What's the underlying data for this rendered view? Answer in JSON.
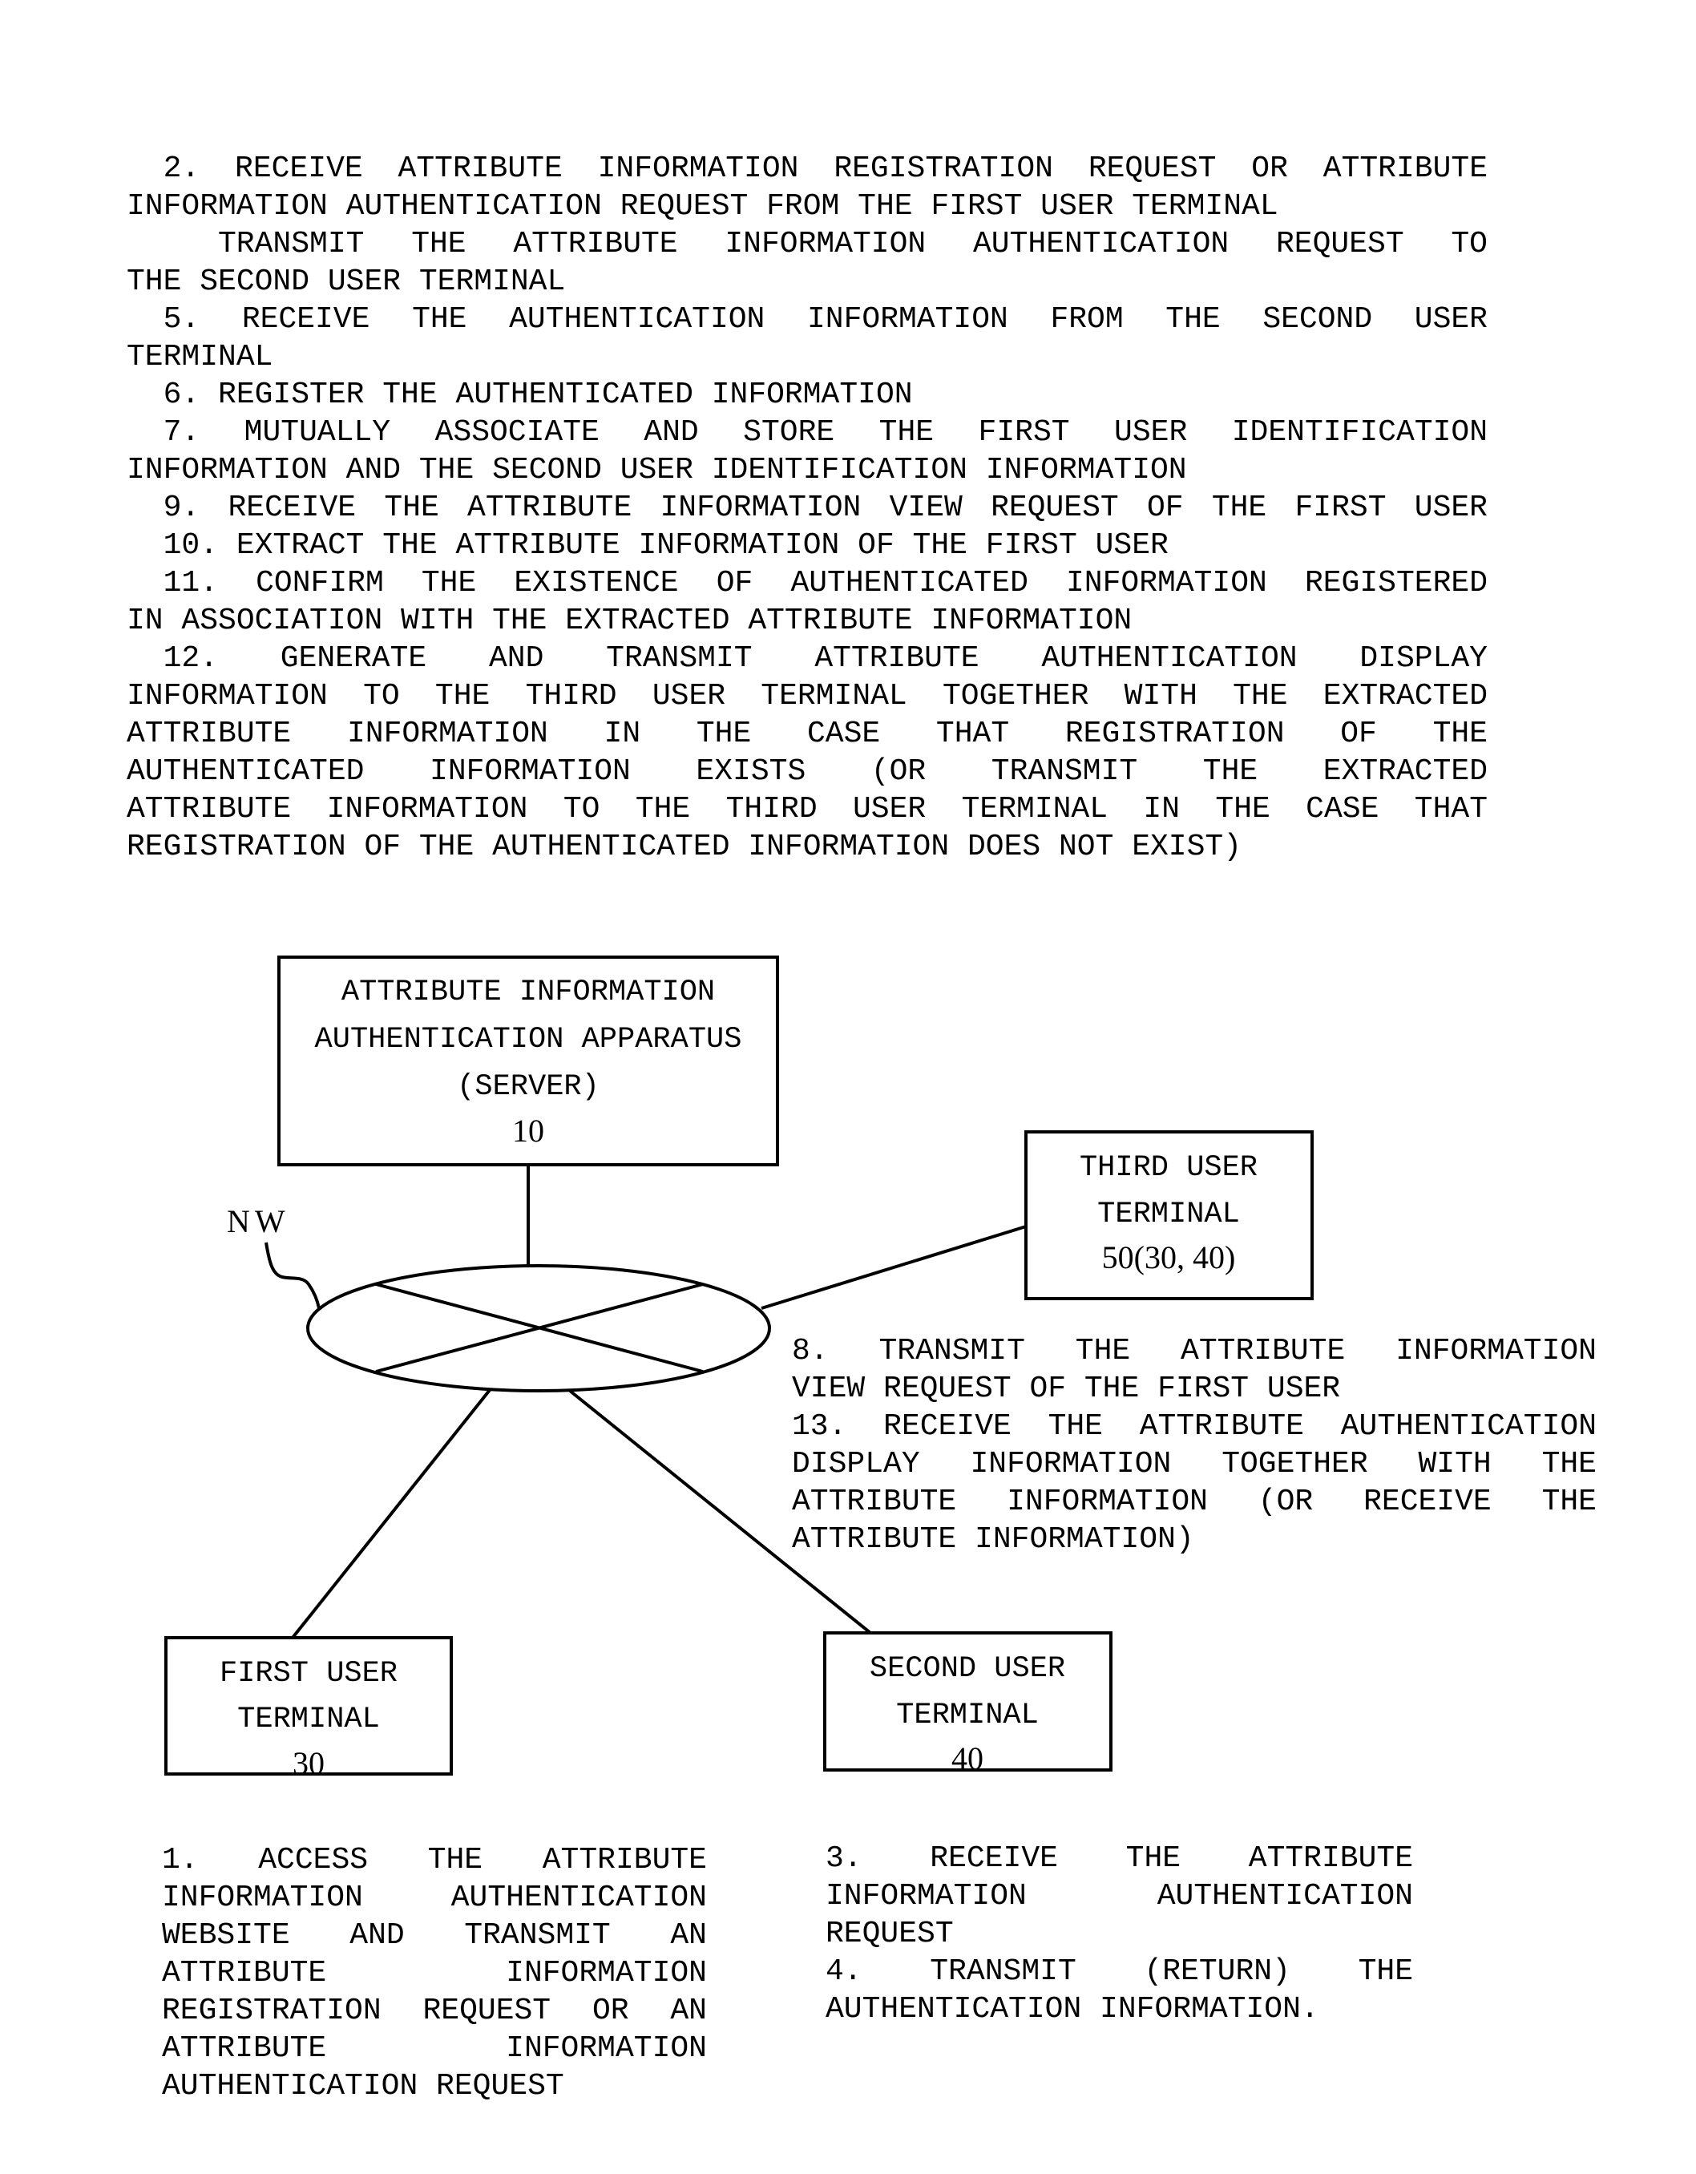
{
  "steps_text": {
    "lines": [
      {
        "text": "  2. RECEIVE ATTRIBUTE INFORMATION REGISTRATION REQUEST OR ATTRIBUTE",
        "justify": true
      },
      {
        "text": "INFORMATION AUTHENTICATION REQUEST FROM THE FIRST USER TERMINAL",
        "justify": false
      },
      {
        "text": "     TRANSMIT THE ATTRIBUTE INFORMATION AUTHENTICATION REQUEST TO",
        "justify": true
      },
      {
        "text": "THE SECOND USER TERMINAL",
        "justify": false
      },
      {
        "text": "  5. RECEIVE THE AUTHENTICATION INFORMATION FROM THE SECOND USER",
        "justify": true
      },
      {
        "text": "TERMINAL",
        "justify": false
      },
      {
        "text": "  6. REGISTER THE AUTHENTICATED INFORMATION",
        "justify": false
      },
      {
        "text": "  7. MUTUALLY ASSOCIATE AND STORE THE FIRST USER IDENTIFICATION",
        "justify": true
      },
      {
        "text": "INFORMATION AND THE SECOND USER IDENTIFICATION INFORMATION",
        "justify": false
      },
      {
        "text": "  9. RECEIVE THE ATTRIBUTE INFORMATION VIEW REQUEST OF THE FIRST USER",
        "justify": true
      },
      {
        "text": "  10. EXTRACT THE ATTRIBUTE INFORMATION OF THE FIRST USER",
        "justify": false
      },
      {
        "text": "  11. CONFIRM THE EXISTENCE OF AUTHENTICATED INFORMATION REGISTERED",
        "justify": true
      },
      {
        "text": "IN ASSOCIATION WITH THE EXTRACTED ATTRIBUTE INFORMATION",
        "justify": false
      },
      {
        "text": "  12. GENERATE AND TRANSMIT ATTRIBUTE AUTHENTICATION DISPLAY",
        "justify": true
      },
      {
        "text": "INFORMATION TO THE THIRD USER TERMINAL TOGETHER WITH THE EXTRACTED",
        "justify": true
      },
      {
        "text": "ATTRIBUTE INFORMATION IN THE CASE THAT REGISTRATION OF THE",
        "justify": true
      },
      {
        "text": "AUTHENTICATED INFORMATION EXISTS (OR TRANSMIT THE EXTRACTED",
        "justify": true
      },
      {
        "text": "ATTRIBUTE INFORMATION TO THE THIRD USER TERMINAL IN THE CASE THAT",
        "justify": true
      },
      {
        "text": "REGISTRATION OF THE AUTHENTICATED INFORMATION DOES NOT EXIST)",
        "justify": false
      }
    ]
  },
  "diagram": {
    "nodes": {
      "server": {
        "label_lines": [
          "ATTRIBUTE INFORMATION",
          "AUTHENTICATION APPARATUS",
          "(SERVER)"
        ],
        "ref": "10"
      },
      "third_terminal": {
        "label_lines": [
          "THIRD USER",
          "TERMINAL"
        ],
        "ref": "50(30, 40)"
      },
      "first_terminal": {
        "label_lines": [
          "FIRST USER",
          "TERMINAL"
        ],
        "ref": "30"
      },
      "second_terminal": {
        "label_lines": [
          "SECOND USER",
          "TERMINAL"
        ],
        "ref": "40"
      },
      "network": {
        "label": "NW"
      }
    },
    "edges": [
      {
        "from": "server",
        "to": "network"
      },
      {
        "from": "network",
        "to": "third_terminal"
      },
      {
        "from": "network",
        "to": "first_terminal"
      },
      {
        "from": "network",
        "to": "second_terminal"
      }
    ]
  },
  "right_notes": {
    "lines": [
      {
        "text": "8. TRANSMIT THE ATTRIBUTE INFORMATION",
        "justify": true
      },
      {
        "text": "VIEW REQUEST OF THE FIRST USER",
        "justify": false
      },
      {
        "text": "13. RECEIVE THE ATTRIBUTE AUTHENTICATION",
        "justify": true
      },
      {
        "text": "DISPLAY INFORMATION TOGETHER WITH THE",
        "justify": true
      },
      {
        "text": "ATTRIBUTE INFORMATION (OR RECEIVE THE",
        "justify": true
      },
      {
        "text": "ATTRIBUTE INFORMATION)",
        "justify": false
      }
    ]
  },
  "first_notes": {
    "lines": [
      {
        "text": "1. ACCESS THE ATTRIBUTE",
        "justify": true
      },
      {
        "text": "INFORMATION AUTHENTICATION",
        "justify": true
      },
      {
        "text": "WEBSITE AND TRANSMIT AN",
        "justify": true
      },
      {
        "text": "ATTRIBUTE INFORMATION",
        "justify": true
      },
      {
        "text": "REGISTRATION REQUEST OR AN",
        "justify": true
      },
      {
        "text": "ATTRIBUTE INFORMATION",
        "justify": true
      },
      {
        "text": "AUTHENTICATION REQUEST",
        "justify": false
      }
    ]
  },
  "second_notes": {
    "lines": [
      {
        "text": "3. RECEIVE THE ATTRIBUTE",
        "justify": true
      },
      {
        "text": "INFORMATION AUTHENTICATION",
        "justify": true
      },
      {
        "text": "REQUEST",
        "justify": false
      },
      {
        "text": "4. TRANSMIT (RETURN) THE",
        "justify": true
      },
      {
        "text": "AUTHENTICATION INFORMATION.",
        "justify": false
      }
    ]
  }
}
